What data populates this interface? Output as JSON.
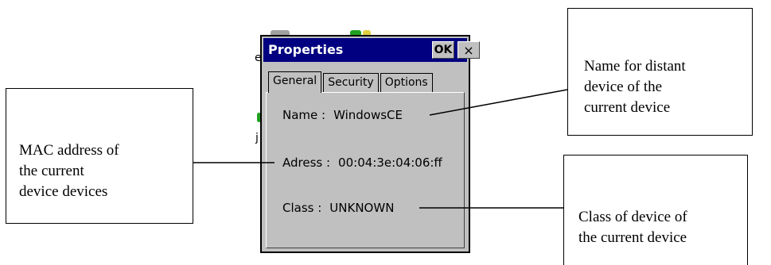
{
  "dialog": {
    "title": "Properties",
    "ok_label": "OK",
    "close_label": "×",
    "tabs": [
      {
        "label": "General",
        "active": true
      },
      {
        "label": "Security",
        "active": false
      },
      {
        "label": "Options",
        "active": false
      }
    ],
    "fields": {
      "name_label": "Name :",
      "name_value": "WindowsCE",
      "address_label": "Adress :",
      "address_value": "00:04:3e:04:06:ff",
      "class_label": "Class :",
      "class_value": "UNKNOWN"
    }
  },
  "background": {
    "fragment_1": "e",
    "fragment_2": "j"
  },
  "callouts": {
    "name": {
      "lines": [
        "Name for distant",
        "device of the",
        "current device"
      ]
    },
    "mac": {
      "lines": [
        "MAC address of",
        "the current",
        "device devices"
      ]
    },
    "class": {
      "lines": [
        "Class of device of",
        "the current device"
      ]
    }
  },
  "colors": {
    "titlebar": "#000080",
    "dialog_face": "#c0c0c0"
  }
}
